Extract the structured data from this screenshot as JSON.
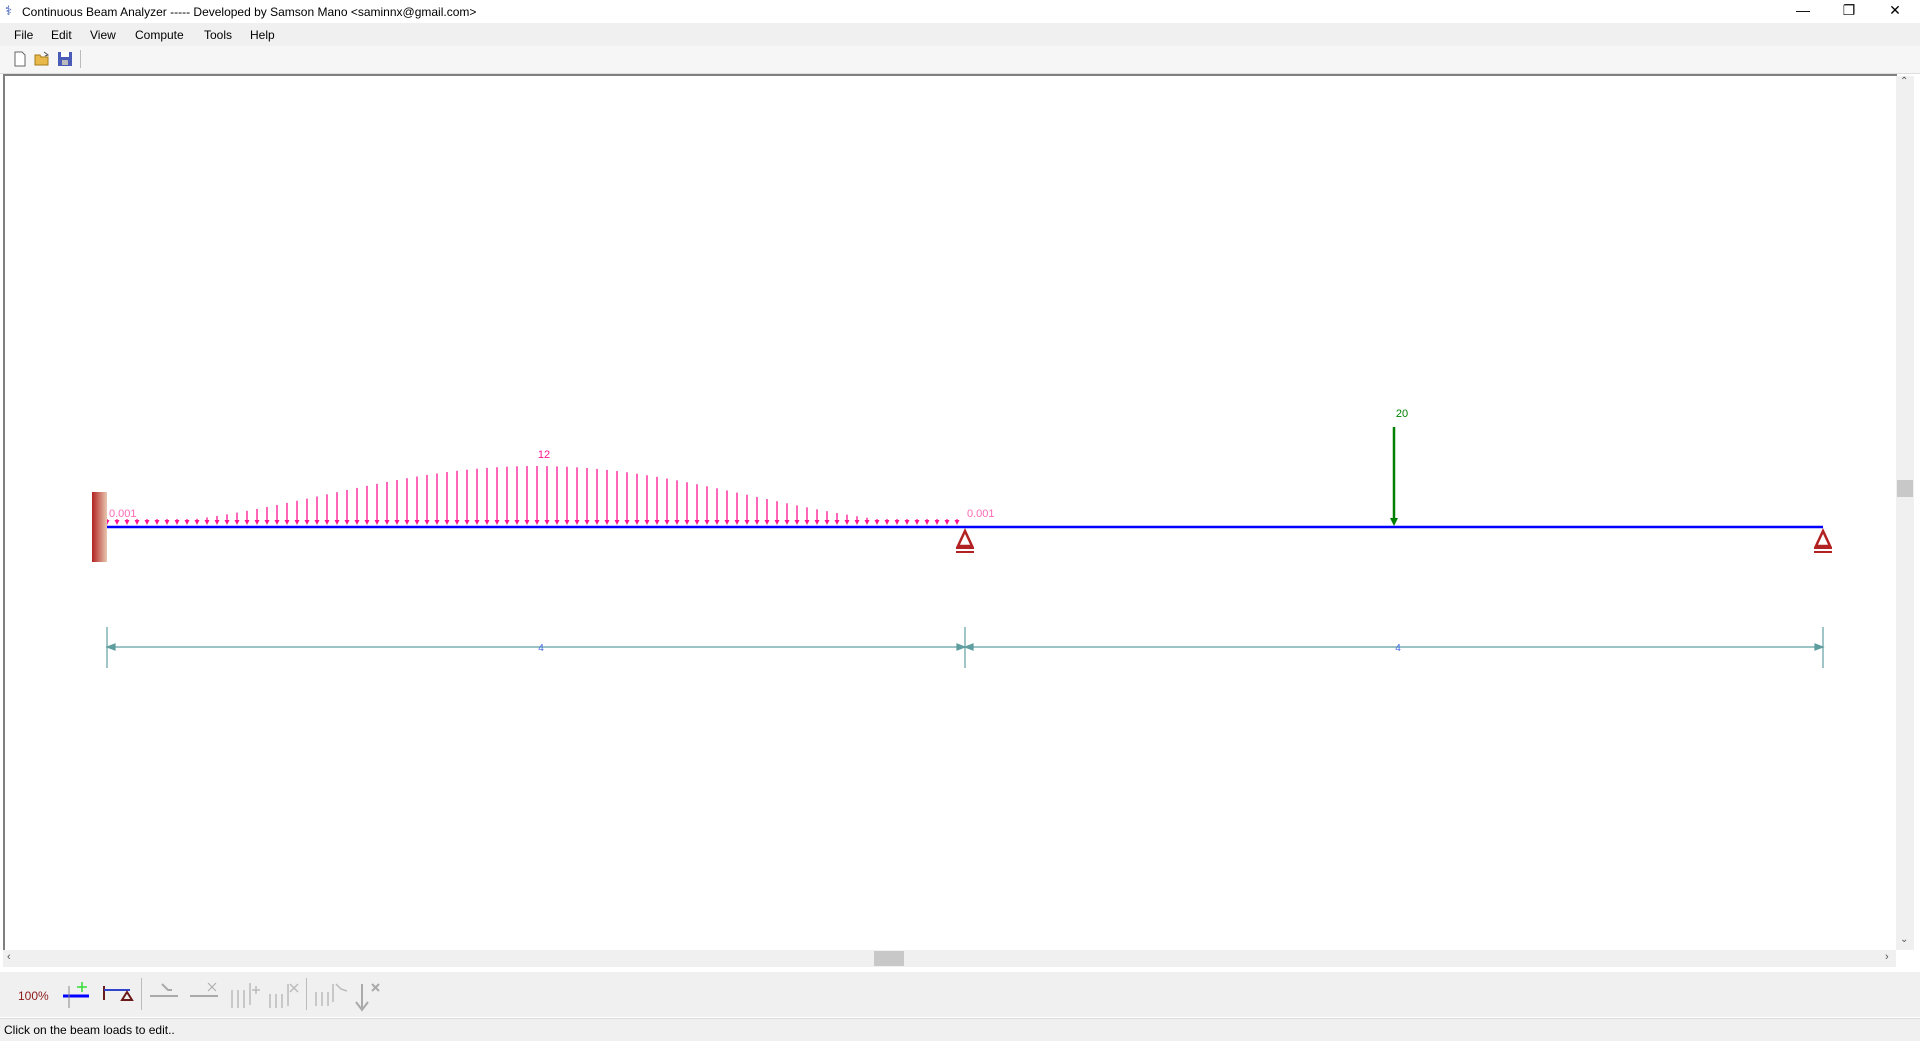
{
  "window": {
    "title": "Continuous Beam Analyzer ----- Developed by Samson Mano <saminnx@gmail.com>",
    "minimize_icon": "minimize-icon",
    "restore_icon": "restore-icon",
    "close_icon": "close-icon"
  },
  "menu": [
    "File",
    "Edit",
    "View",
    "Compute",
    "Tools",
    "Help"
  ],
  "toolbar": {
    "icons": [
      "new-file-icon",
      "open-folder-icon",
      "save-icon"
    ]
  },
  "bottom_toolbar": {
    "zoom_level": "100%",
    "icons": [
      "add-span-icon",
      "edit-supports-icon",
      "edit-span-icon",
      "delete-span-icon",
      "add-distributed-load-icon",
      "delete-distributed-load-icon",
      "edit-distributed-load-icon",
      "delete-point-load-icon"
    ]
  },
  "status": "Click on the beam  loads to edit..",
  "colors": {
    "beam": "#0000ff",
    "distributed_load": "#ff1493",
    "point_load": "#008000",
    "support": "#b22222",
    "dimension": "#5f9ea0",
    "dimension_text": "#4169e1"
  },
  "beam": {
    "spans": [
      4,
      4
    ],
    "span_labels": [
      "4",
      "4"
    ],
    "supports": [
      "fixed",
      "pinned",
      "pinned"
    ],
    "distributed_load": {
      "span": 1,
      "start_value": "0.001",
      "peak_value": "12",
      "end_value": "0.001"
    },
    "point_load": {
      "span": 2,
      "position": 2,
      "value": "20"
    }
  }
}
